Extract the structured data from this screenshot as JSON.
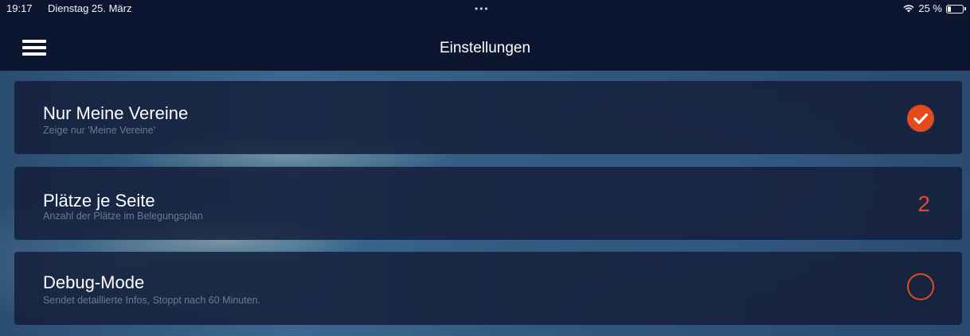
{
  "status_bar": {
    "time": "19:17",
    "date": "Dienstag 25. März",
    "multitask_dots": "•••",
    "battery_text": "25 %",
    "battery_level": 0.25,
    "wifi_icon": "wifi-icon",
    "battery_icon": "battery-icon"
  },
  "nav": {
    "title": "Einstellungen",
    "menu_icon": "hamburger-menu-icon"
  },
  "settings": [
    {
      "label": "Nur Meine Vereine",
      "description": "Zeige nur 'Meine Vereine'",
      "control": "checkbox",
      "checked": true
    },
    {
      "label": "Plätze je Seite",
      "description": "Anzahl der Plätze im Belegungsplan",
      "control": "value",
      "value": "2"
    },
    {
      "label": "Debug-Mode",
      "description": "Sendet detaillierte Infos, Stoppt nach 60 Minuten.",
      "control": "checkbox",
      "checked": false
    }
  ],
  "colors": {
    "accent": "#e44b1c",
    "bar_background": "#0d1630",
    "card_background": "#121c37"
  }
}
